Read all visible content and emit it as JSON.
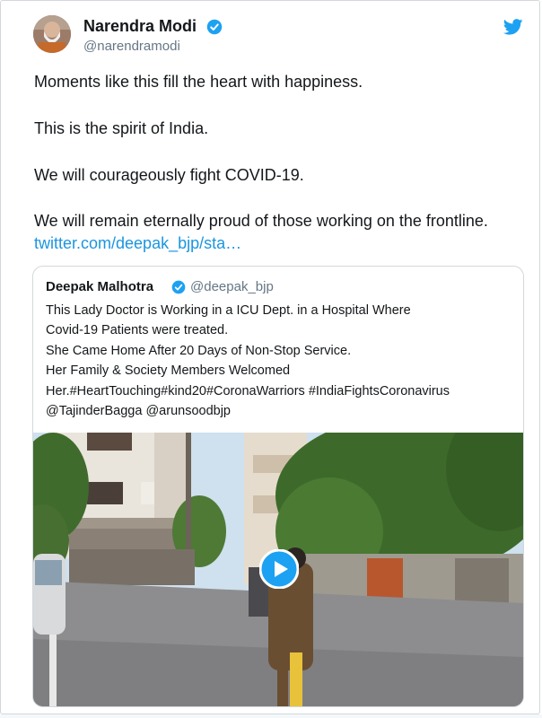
{
  "tweet": {
    "author_name": "Narendra Modi",
    "author_handle": "@narendramodi",
    "lines": [
      "Moments like this fill the heart with happiness.",
      "This is the spirit of India.",
      "We will courageously fight COVID-19.",
      "We will remain eternally proud of those working on the frontline."
    ],
    "link_text": "twitter.com/deepak_bjp/sta…"
  },
  "quoted": {
    "author_name": "Deepak Malhotra",
    "author_handle": "@deepak_bjp",
    "lines": [
      "This Lady Doctor is Working in a ICU Dept. in a Hospital Where",
      "Covid-19 Patients were treated.",
      "She Came Home After 20 Days of Non-Stop Service.",
      "Her Family & Society Members Welcomed",
      "Her.#HeartTouching#kind20#CoronaWarriors #IndiaFightsCoronavirus",
      "@TajinderBagga @arunsoodbjp"
    ]
  },
  "colors": {
    "twitter_blue": "#1da1f2",
    "link": "#1b95e0",
    "text": "#14171a",
    "muted": "#657786"
  },
  "icons": [
    "twitter-bird-icon",
    "verified-badge-icon",
    "play-icon"
  ]
}
